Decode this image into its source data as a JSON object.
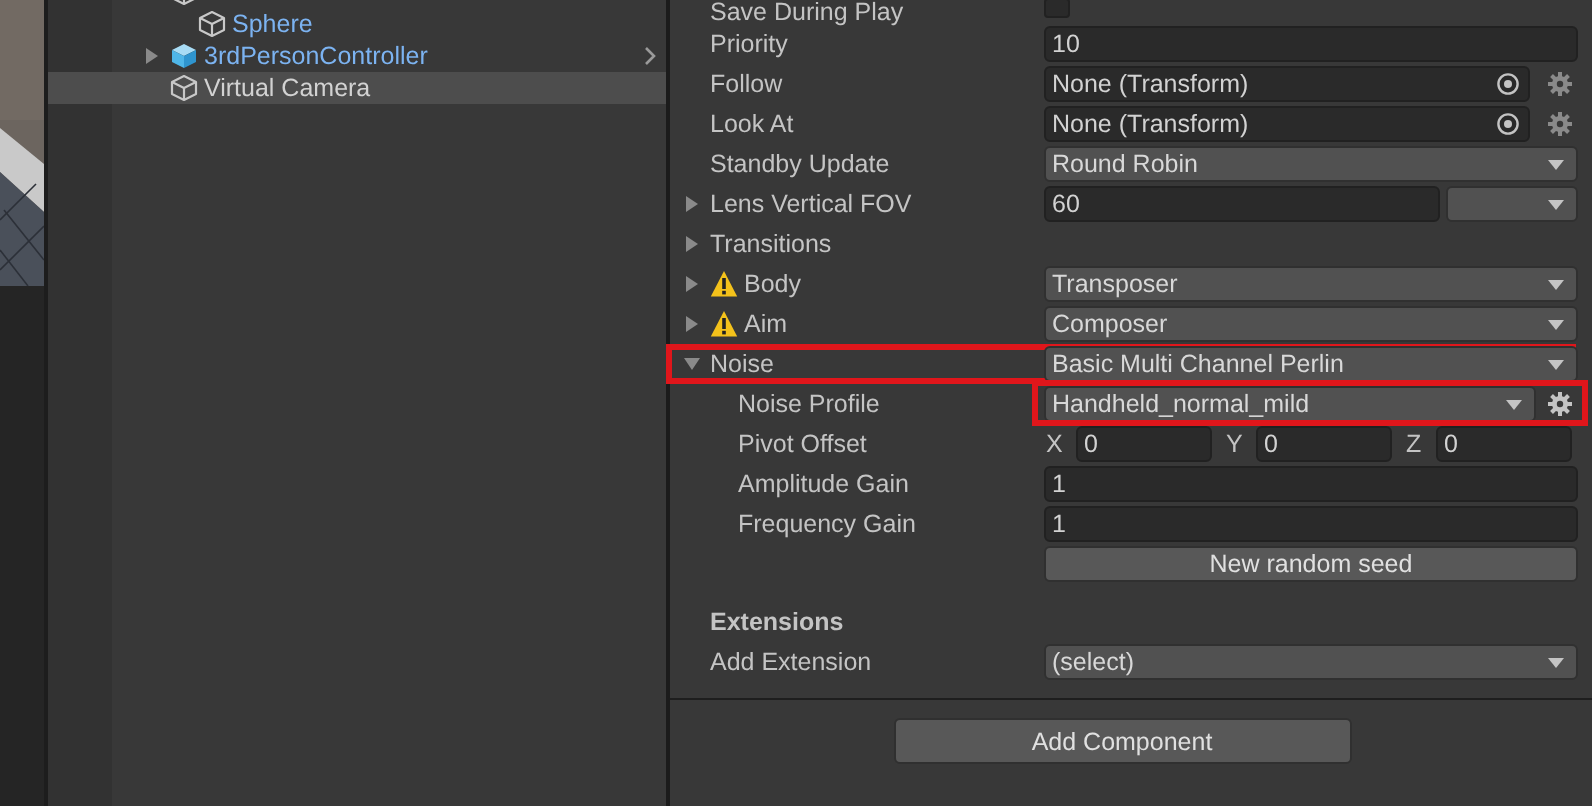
{
  "hierarchy": {
    "items": [
      {
        "kind": "object",
        "selected": false,
        "children": [
          {
            "name": "Sphere",
            "kind": "prefab_part",
            "selected": false
          }
        ]
      },
      {
        "name": "3rdPersonController",
        "kind": "prefab_root",
        "expanded": false,
        "selected": false
      },
      {
        "name": "Virtual Camera",
        "kind": "object",
        "selected": true
      }
    ]
  },
  "inspector": {
    "rows": [
      {
        "kind": "checkbox",
        "label": "Save During Play",
        "checked": false
      },
      {
        "kind": "text",
        "label": "Priority",
        "value": "10"
      },
      {
        "kind": "object",
        "label": "Follow",
        "value": "None (Transform)"
      },
      {
        "kind": "object",
        "label": "Look At",
        "value": "None (Transform)"
      },
      {
        "kind": "dropdown",
        "label": "Standby Update",
        "value": "Round Robin"
      },
      {
        "kind": "text_dropdown",
        "label": "Lens Vertical FOV",
        "value": "60",
        "expanded": false
      },
      {
        "kind": "foldout",
        "label": "Transitions",
        "expanded": false
      },
      {
        "kind": "dropdown",
        "label": "Body",
        "value": "Transposer",
        "expanded": false,
        "warning": true
      },
      {
        "kind": "dropdown",
        "label": "Aim",
        "value": "Composer",
        "expanded": false,
        "warning": true
      },
      {
        "kind": "dropdown",
        "label": "Noise",
        "value": "Basic Multi Channel Perlin",
        "expanded": true,
        "highlighted": true,
        "children": [
          {
            "kind": "asset",
            "label": "Noise Profile",
            "value": "Handheld_normal_mild",
            "highlighted": true
          },
          {
            "kind": "vector3",
            "label": "Pivot Offset",
            "axes": [
              {
                "axis": "X",
                "value": "0"
              },
              {
                "axis": "Y",
                "value": "0"
              },
              {
                "axis": "Z",
                "value": "0"
              }
            ]
          },
          {
            "kind": "text",
            "label": "Amplitude Gain",
            "value": "1"
          },
          {
            "kind": "text",
            "label": "Frequency Gain",
            "value": "1"
          },
          {
            "kind": "button",
            "value": "New random seed"
          }
        ]
      }
    ]
  },
  "extensions": {
    "heading": "Extensions",
    "rows": [
      {
        "kind": "dropdown",
        "label": "Add Extension",
        "value": "(select)"
      }
    ]
  },
  "add_component_button": "Add Component"
}
